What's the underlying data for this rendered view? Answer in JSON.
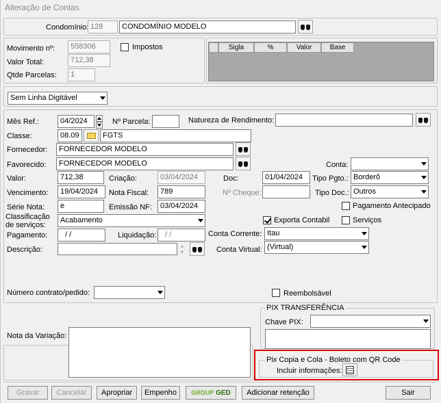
{
  "window": {
    "title": "Alteração de Contas"
  },
  "top": {
    "condominio_label": "Condomínio:",
    "condominio_code": "128",
    "condominio_name": "CONDOMÍNIO MODELO",
    "movimento_label": "Movimento nº:",
    "movimento_value": "558306",
    "valor_total_label": "Valor Total:",
    "valor_total_value": "712,38",
    "qtde_parcelas_label": "Qtde Parcelas:",
    "qtde_parcelas_value": "1",
    "impostos_label": "Impostos",
    "tax_columns": [
      "Sigla",
      "%",
      "Valor",
      "Base"
    ]
  },
  "linha_digitavel": {
    "selected": "Sem Linha Digitável"
  },
  "form": {
    "mes_ref_label": "Mês Ref.:",
    "mes_ref_value": "04/2024",
    "n_parcela_label": "Nº Parcela:",
    "n_parcela_value": "",
    "natureza_label": "Natureza de Rendimento:",
    "natureza_value": "",
    "classe_label": "Classe:",
    "classe_code": "08.09",
    "classe_name": "FGTS",
    "fornecedor_label": "Fornecedor:",
    "fornecedor_value": "FORNECEDOR MODELO",
    "favorecido_label": "Favorecido:",
    "favorecido_value": "FORNECEDOR MODELO",
    "conta_label": "Conta:",
    "conta_value": "",
    "valor_label": "Valor:",
    "valor_value": "712,38",
    "criacao_label": "Criação:",
    "criacao_value": "03/04/2024",
    "doc_label": "Doc:",
    "doc_value": "01/04/2024",
    "tipo_pgto_label": "Tipo Pgto.:",
    "tipo_pgto_value": "Borderô",
    "vencimento_label": "Vencimento:",
    "vencimento_value": "19/04/2024",
    "nota_fiscal_label": "Nota Fiscal:",
    "nota_fiscal_value": "789",
    "n_cheque_label": "Nº Cheque:",
    "n_cheque_value": "",
    "tipo_doc_label": "Tipo Doc.:",
    "tipo_doc_value": "Outros",
    "serie_label": "Série Nota:",
    "serie_value": "e",
    "emissao_label": "Emissão NF:",
    "emissao_value": "03/04/2024",
    "pag_antecipado_label": "Pagamento Antecipado",
    "classificacao_label_1": "Classificação",
    "classificacao_label_2": "de serviços:",
    "classificacao_value": "Acabamento",
    "exporta_label": "Exporta Contabil",
    "servicos_label": "Serviços",
    "pagamento_label": "Pagamento:",
    "pagamento_value": "/ /",
    "liquidacao_label": "Liquidação:",
    "liquidacao_value": "/ /",
    "conta_corrente_label": "Conta Corrente:",
    "conta_corrente_value": "Itau",
    "descricao_label": "Descrição:",
    "descricao_value": "",
    "conta_virtual_label": "Conta Virtual:",
    "conta_virtual_value": "(Virtual)",
    "numero_contrato_label": "Número contrato/pedido:",
    "numero_contrato_value": "",
    "reembolsavel_label": "Reembolsável"
  },
  "pix": {
    "transfer_title": "PIX TRANSFERÊNCIA",
    "chave_label": "Chave PIX:",
    "chave_value": "",
    "copia_title": "Pix Copia e Cola - Boleto com QR Code",
    "incluir_label": "Incluir informações:"
  },
  "nota_variacao_label": "Nota da Variação:",
  "buttons": {
    "gravar": "Gravar",
    "cancelar": "Cancelar",
    "apropriar": "Apropriar",
    "empenho": "Empenho",
    "ged_group": "GROUP",
    "ged": "GED",
    "adicionar": "Adicionar retenção",
    "sair": "Sair"
  },
  "colors": {
    "highlight": "#e00000",
    "accent_green": "#4a8a1c"
  }
}
